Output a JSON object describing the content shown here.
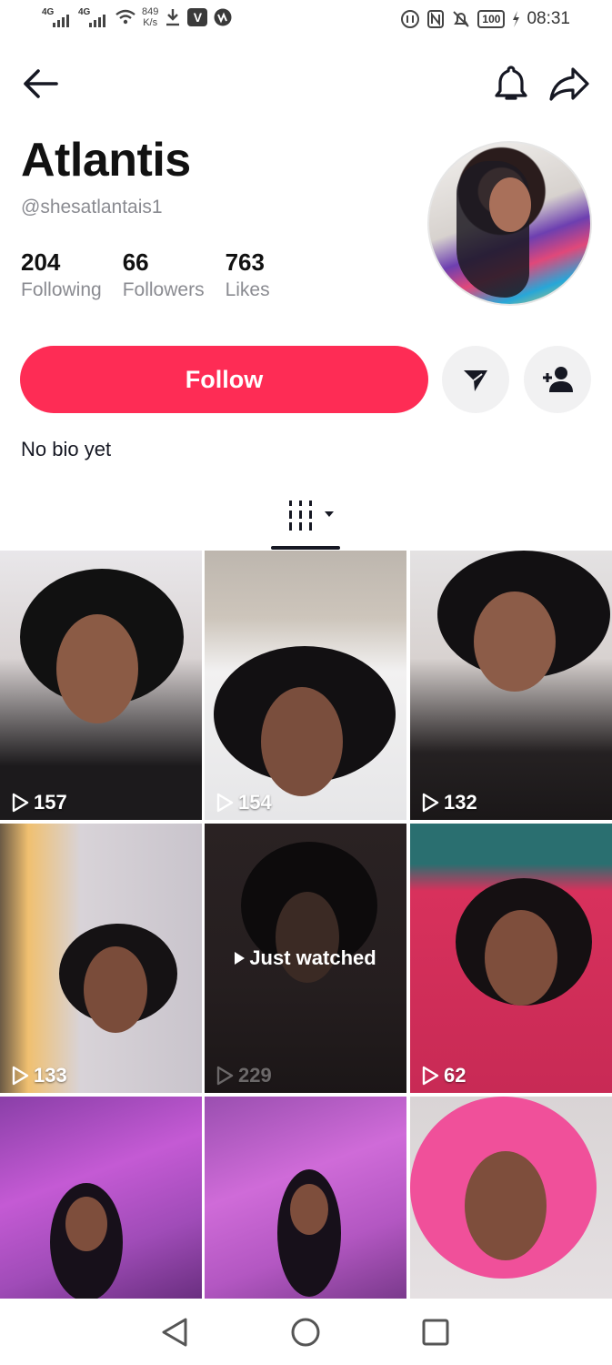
{
  "status_bar": {
    "network_1": "4G",
    "network_2": "4G",
    "speed_value": "849",
    "speed_unit": "K/s",
    "battery": "100",
    "time": "08:31"
  },
  "profile": {
    "name": "Atlantis",
    "handle": "@shesatlantais1",
    "stats": [
      {
        "value": "204",
        "label": "Following"
      },
      {
        "value": "66",
        "label": "Followers"
      },
      {
        "value": "763",
        "label": "Likes"
      }
    ],
    "bio": "No bio yet"
  },
  "actions": {
    "follow_label": "Follow"
  },
  "icons": {
    "back": "arrow-left-icon",
    "notifications": "bell-icon",
    "share": "share-arrow-icon",
    "message": "send-icon",
    "add_friend": "add-user-icon",
    "videos_tab": "grid-columns-icon"
  },
  "videos": [
    {
      "views": "157"
    },
    {
      "views": "154"
    },
    {
      "views": "132"
    },
    {
      "views": "133"
    },
    {
      "views": "229",
      "overlay": "Just watched"
    },
    {
      "views": "62"
    },
    {
      "views": ""
    },
    {
      "views": ""
    },
    {
      "views": ""
    }
  ],
  "colors": {
    "accent": "#fe2c55",
    "text_secondary": "#8a8b91",
    "button_secondary_bg": "#f1f1f2"
  }
}
